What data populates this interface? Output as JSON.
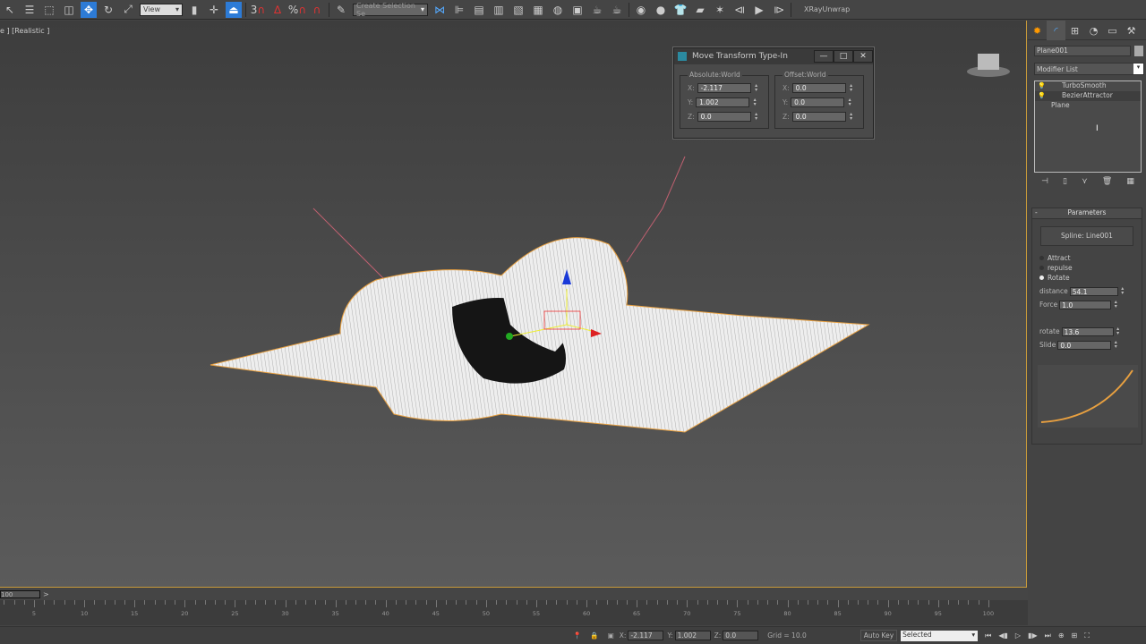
{
  "toolbar": {
    "reference_coord": "View",
    "selection_set_placeholder": "Create Selection Se",
    "xray_label": "XRayUnwrap",
    "snap_labels": [
      "3",
      "%"
    ]
  },
  "viewport": {
    "label": "e ] [Realistic ]"
  },
  "dialog": {
    "title": "Move Transform Type-In",
    "absolute_title": "Absolute:World",
    "offset_title": "Offset:World",
    "absolute": [
      {
        "axis": "X:",
        "value": "-2.117"
      },
      {
        "axis": "Y:",
        "value": "1.002"
      },
      {
        "axis": "Z:",
        "value": "0.0"
      }
    ],
    "offset": [
      {
        "axis": "X:",
        "value": "0.0"
      },
      {
        "axis": "Y:",
        "value": "0.0"
      },
      {
        "axis": "Z:",
        "value": "0.0"
      }
    ],
    "minimize": "—",
    "maximize": "□",
    "close": "✕"
  },
  "panel": {
    "object_name": "Plane001",
    "modifier_list": "Modifier List",
    "stack": [
      "TurboSmooth",
      "BezierAttractor",
      "Plane"
    ],
    "params_title": "Parameters",
    "spline_button": "Spline: Line001",
    "modes": [
      {
        "label": "Attract",
        "on": false
      },
      {
        "label": "repulse",
        "on": false
      },
      {
        "label": "Rotate",
        "on": true
      }
    ],
    "distance_label": "distance",
    "distance": "54.1",
    "force_label": "Force",
    "force": "1.0",
    "rotate_label": "rotate",
    "rotate": "13.6",
    "slide_label": "Slide",
    "slide": "0.0",
    "collapse": "-"
  },
  "timeline": {
    "slider": "100",
    "arrow": ">",
    "ticks": [
      "5",
      "10",
      "15",
      "20",
      "25",
      "30",
      "35",
      "40",
      "45",
      "50",
      "55",
      "60",
      "65",
      "70",
      "75",
      "80",
      "85",
      "90",
      "95",
      "100"
    ]
  },
  "status": {
    "x_label": "X:",
    "x": "-2.117",
    "y_label": "Y:",
    "y": "1.002",
    "z_label": "Z:",
    "z": "0.0",
    "grid": "Grid = 10.0",
    "auto_key": "Auto Key",
    "key_filter": "Selected"
  },
  "colors": {
    "accent": "#2d7bd6",
    "selection": "#e8a040",
    "viewport_border": "#c89a3a"
  }
}
